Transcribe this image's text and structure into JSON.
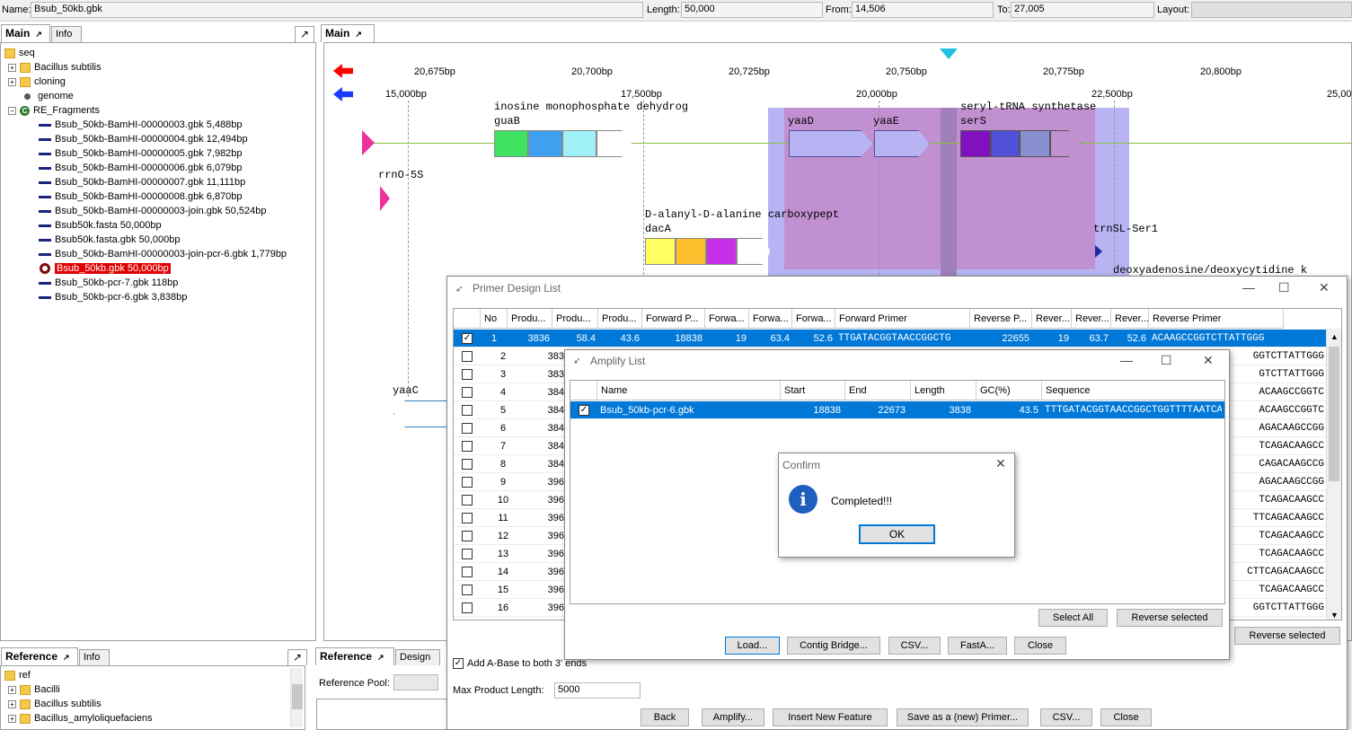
{
  "top": {
    "name_label": "Name:",
    "name_value": "Bsub_50kb.gbk",
    "length_label": "Length:",
    "length_value": "50,000",
    "from_label": "From:",
    "from_value": "14,506",
    "to_label": "To:",
    "to_value": "27,005",
    "layout_label": "Layout:"
  },
  "left_tabs": {
    "main": "Main",
    "info": "Info"
  },
  "tree": {
    "root": "seq",
    "folders": [
      "Bacillus subtilis",
      "cloning"
    ],
    "genome": "genome",
    "re_fragments": "RE_Fragments",
    "fragments": [
      "Bsub_50kb-BamHI-00000003.gbk 5,488bp",
      "Bsub_50kb-BamHI-00000004.gbk 12,494bp",
      "Bsub_50kb-BamHI-00000005.gbk 7,982bp",
      "Bsub_50kb-BamHI-00000006.gbk 6,079bp",
      "Bsub_50kb-BamHI-00000007.gbk 11,111bp",
      "Bsub_50kb-BamHI-00000008.gbk 6,870bp",
      "Bsub_50kb-BamHI-00000003-join.gbk 50,524bp",
      "Bsub50k.fasta 50,000bp",
      "Bsub50k.fasta.gbk 50,000bp",
      "Bsub_50kb-BamHI-00000003-join-pcr-6.gbk 1,779bp",
      "Bsub_50kb.gbk 50,000bp",
      "Bsub_50kb-pcr-7.gbk 118bp",
      "Bsub_50kb-pcr-6.gbk 3,838bp"
    ],
    "selected_index": 10
  },
  "ref_tabs": {
    "reference": "Reference",
    "info": "Info"
  },
  "ref_tree": {
    "root": "ref",
    "items": [
      "Bacilli",
      "Bacillus subtilis",
      "Bacillus_amyloliquefaciens"
    ]
  },
  "main_tab": "Main",
  "ref_design_tabs": {
    "reference": "Reference",
    "design": "Design"
  },
  "reference_pool_label": "Reference Pool:",
  "viewer": {
    "top_ruler": [
      "20,675bp",
      "20,700bp",
      "20,725bp",
      "20,750bp",
      "20,775bp",
      "20,800bp"
    ],
    "bottom_ruler": [
      "15,000bp",
      "17,500bp",
      "20,000bp",
      "22,500bp",
      "25,00"
    ],
    "features": {
      "imp": "inosine monophosphate dehydrog",
      "guaB": "guaB",
      "yaaD": "yaaD",
      "yaaE": "yaaE",
      "seryl": "seryl-tRNA synthetase",
      "serS": "serS",
      "rrnO": "rrnO-5S",
      "dacA_desc": "D-alanyl-D-alanine carboxypept",
      "dacA": "dacA",
      "trnSL": "trnSL-Ser1",
      "deoxy": "deoxyadenosine/deoxycytidine k",
      "yaaC": "yaaC"
    },
    "colors": {
      "forward": "#ff0000",
      "reverse": "#1a3cff",
      "marker": "#20c0e0",
      "selection": "#b0a0e8"
    }
  },
  "primer_window": {
    "title": "Primer Design List",
    "headers": [
      "No",
      "Produ...",
      "Produ...",
      "Produ...",
      "Forward P...",
      "Forwa...",
      "Forwa...",
      "Forwa...",
      "Forward Primer",
      "Reverse P...",
      "Rever...",
      "Rever...",
      "Rever...",
      "Reverse Primer"
    ],
    "row1": [
      "1",
      "3836",
      "58.4",
      "43.6",
      "18838",
      "19",
      "63.4",
      "52.6",
      "TTGATACGGTAACCGGCTG",
      "22655",
      "19",
      "63.7",
      "52.6",
      "ACAAGCCGGTCTTATTGGG"
    ],
    "rows": [
      {
        "no": "2",
        "prod": "383",
        "rev": "GGTCTTATTGGG"
      },
      {
        "no": "3",
        "prod": "383",
        "rev": "GTCTTATTGGG"
      },
      {
        "no": "4",
        "prod": "384",
        "rev": "ACAAGCCGGTC"
      },
      {
        "no": "5",
        "prod": "384",
        "rev": "ACAAGCCGGTC"
      },
      {
        "no": "6",
        "prod": "384",
        "rev": "AGACAAGCCGG"
      },
      {
        "no": "7",
        "prod": "384",
        "rev": "TCAGACAAGCC"
      },
      {
        "no": "8",
        "prod": "384",
        "rev": "CAGACAAGCCG"
      },
      {
        "no": "9",
        "prod": "396",
        "rev": "AGACAAGCCGG"
      },
      {
        "no": "10",
        "prod": "396",
        "rev": "TCAGACAAGCC"
      },
      {
        "no": "11",
        "prod": "396",
        "rev": "TTCAGACAAGCC"
      },
      {
        "no": "12",
        "prod": "396",
        "rev": "TCAGACAAGCC"
      },
      {
        "no": "13",
        "prod": "396",
        "rev": "TCAGACAAGCC"
      },
      {
        "no": "14",
        "prod": "396",
        "rev": "CTTCAGACAAGCC"
      },
      {
        "no": "15",
        "prod": "396",
        "rev": "TCAGACAAGCC"
      },
      {
        "no": "16",
        "prod": "396",
        "rev": "GGTCTTATTGGG"
      }
    ],
    "add_abase": "Add A-Base to both 3' ends",
    "max_len_label": "Max Product Length:",
    "max_len_value": "5000",
    "reverse_selected": "Reverse selected",
    "buttons": {
      "back": "Back",
      "amplify": "Amplify...",
      "insert": "Insert New Feature",
      "save": "Save as a (new) Primer...",
      "csv": "CSV...",
      "close": "Close"
    }
  },
  "amplify_window": {
    "title": "Amplify List",
    "headers": [
      "Name",
      "Start",
      "End",
      "Length",
      "GC(%)",
      "Sequence"
    ],
    "row": [
      "Bsub_50kb-pcr-6.gbk",
      "18838",
      "22673",
      "3838",
      "43.5",
      "TTTGATACGGTAACCGGCTGGTTTTAATCA..."
    ],
    "buttons": {
      "select_all": "Select All",
      "reverse_selected": "Reverse selected",
      "load": "Load...",
      "contig": "Contig Bridge...",
      "csv": "CSV...",
      "fasta": "FastA...",
      "close": "Close"
    }
  },
  "confirm": {
    "title": "Confirm",
    "message": "Completed!!!",
    "ok": "OK"
  }
}
